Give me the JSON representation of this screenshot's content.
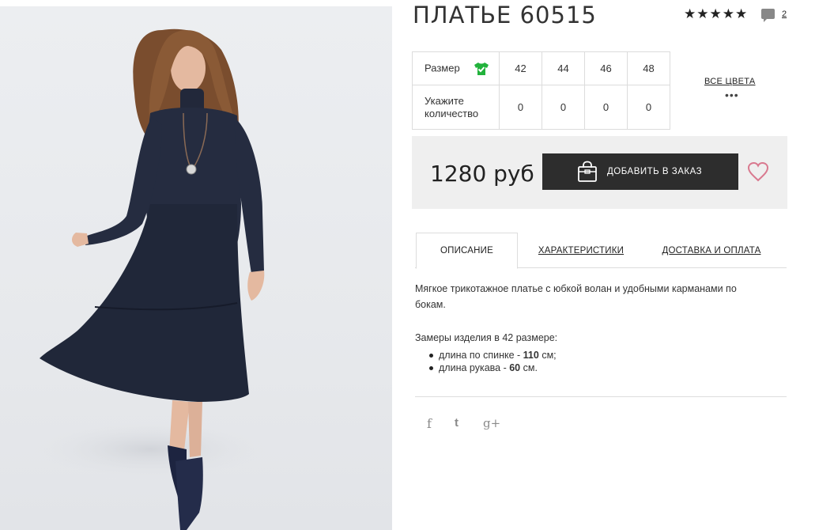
{
  "product": {
    "title": "ПЛАТЬЕ 60515",
    "rating_stars": "★★★★★",
    "comment_count": "2"
  },
  "sizes": {
    "size_label": "Размер",
    "qty_label_1": "Укажите",
    "qty_label_2": "количество",
    "values": [
      "42",
      "44",
      "46",
      "48"
    ],
    "quantities": [
      "0",
      "0",
      "0",
      "0"
    ]
  },
  "colors": {
    "all_colors_label": "ВСЕ ЦВЕТА",
    "more": "•••"
  },
  "order": {
    "price": "1280 руб",
    "button_label": "ДОБАВИТЬ В ЗАКАЗ"
  },
  "tabs": [
    {
      "label": "ОПИСАНИЕ"
    },
    {
      "label": "ХАРАКТЕРИСТИКИ"
    },
    {
      "label": "ДОСТАВКА И ОПЛАТА"
    }
  ],
  "description": {
    "line1": "Мягкое трикотажное платье с юбкой волан и удобными карманами по",
    "line2": "бокам.",
    "measures_title": "Замеры изделия в 42 размере:",
    "measures": [
      {
        "prefix": "длина по спинке - ",
        "value": "110",
        "suffix": " см;"
      },
      {
        "prefix": "длина рукава - ",
        "value": "60",
        "suffix": " см."
      }
    ]
  },
  "social": {
    "facebook": "f",
    "twitter": "t",
    "google": "g+"
  },
  "icons": [
    "star-icon",
    "comment-icon",
    "shirt-check-icon",
    "shopping-bag-icon",
    "heart-icon",
    "facebook-icon",
    "twitter-icon",
    "google-plus-icon"
  ],
  "colors_palette": {
    "accent_green": "#22b23c",
    "button_dark": "#2d2d2d",
    "heart_pink": "#d9798f",
    "panel_grey": "#efefef"
  }
}
